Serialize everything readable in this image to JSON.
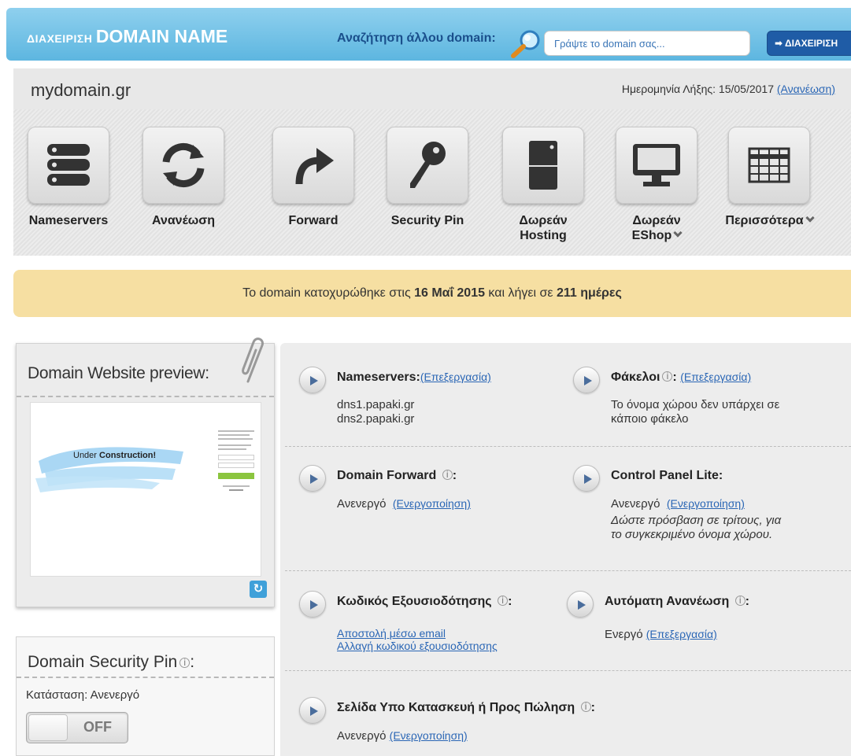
{
  "header": {
    "brand_small": "ΔΙΑΧΕΙΡΙΣΗ",
    "brand_big": "DOMAIN NAME",
    "search_label": "Αναζήτηση άλλου domain:",
    "search_placeholder": "Γράψτε το domain σας...",
    "manage_button": "➡ ΔΙΑΧΕΙΡΙΣΗ"
  },
  "domain": {
    "name": "mydomain.gr",
    "expiry_label": "Ημερομηνία Λήξης: 15/05/2017",
    "renew_link": "(Ανανέωση)"
  },
  "toolbar": {
    "items": [
      {
        "label": "Nameservers",
        "icon": "server-icon"
      },
      {
        "label": "Ανανέωση",
        "icon": "refresh-icon"
      },
      {
        "label": "Forward",
        "icon": "forward-arrow-icon"
      },
      {
        "label": "Security Pin",
        "icon": "key-icon"
      },
      {
        "label_line1": "Δωρεάν",
        "label_line2": "Hosting",
        "icon": "hosting-box-icon"
      },
      {
        "label_line1": "Δωρεάν",
        "label_line2": "EShop",
        "icon": "monitor-icon"
      },
      {
        "label": "Περισσότερα",
        "icon": "grid-icon"
      }
    ]
  },
  "notice": {
    "part1": "Το domain κατοχυρώθηκε στις ",
    "date": "16 Μαΐ 2015",
    "part2": " και λήγει σε ",
    "days": "211 ημέρες"
  },
  "preview": {
    "title": "Domain Website preview:",
    "banner_text_plain": "Under ",
    "banner_text_bold": "Construction!"
  },
  "security_pin": {
    "title": "Domain Security Pin",
    "status": "Κατάσταση: Ανενεργό",
    "toggle_label": "OFF"
  },
  "details": {
    "nameservers": {
      "title": "Nameservers:",
      "link": "(Επεξεργασία)",
      "lines": [
        "dns1.papaki.gr",
        "dns2.papaki.gr"
      ]
    },
    "folders": {
      "title": "Φάκελοι",
      "link": "(Επεξεργασία)",
      "lines": [
        "Το όνομα χώρου δεν υπάρχει σε",
        "κάποιο φάκελο"
      ]
    },
    "forward": {
      "title": "Domain Forward",
      "status": "Ανενεργό",
      "link": "(Ενεργοποίηση)"
    },
    "control_panel": {
      "title": "Control Panel Lite:",
      "status": "Ανενεργό",
      "link": "(Ενεργοποίηση)",
      "desc1": "Δώστε πρόσβαση σε τρίτους, για",
      "desc2": "το συγκεκριμένο όνομα χώρου."
    },
    "auth_code": {
      "title": "Κωδικός Εξουσιοδότησης",
      "link1": "Αποστολή μέσω email",
      "link2": "Αλλαγή κωδικού εξουσιοδότησης"
    },
    "auto_renew": {
      "title": "Αυτόματη Ανανέωση",
      "status": "Ενεργό",
      "link": "(Επεξεργασία)"
    },
    "parking": {
      "title": "Σελίδα Υπο Κατασκευή ή Προς Πώληση",
      "status": "Ανενεργό",
      "link": "(Ενεργοποίηση)"
    }
  },
  "colors": {
    "header_blue": "#5db6e0",
    "notice_yellow": "#f6dfa2",
    "link_blue": "#2a66b5",
    "button_blue": "#1f5ca6"
  }
}
